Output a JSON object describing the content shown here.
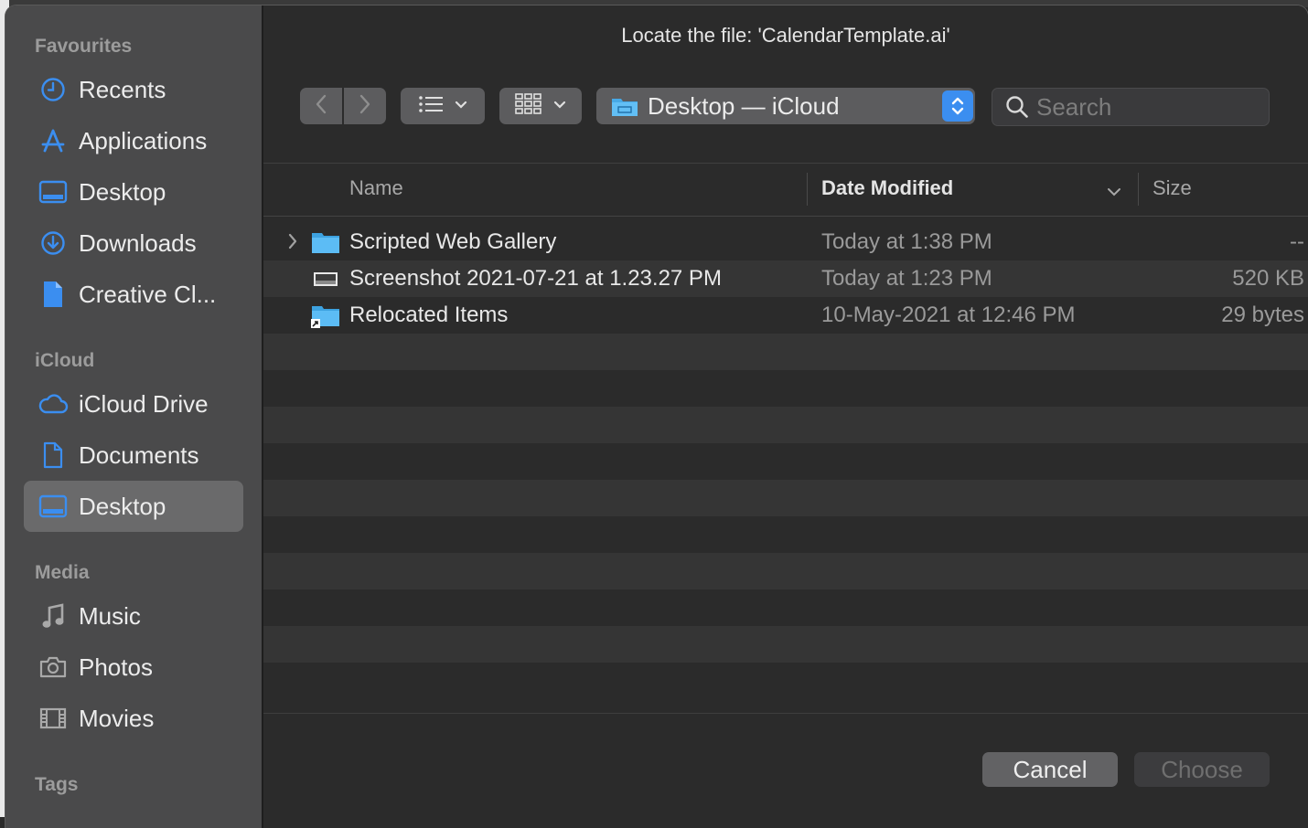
{
  "dialog": {
    "title": "Locate the file: 'CalendarTemplate.ai'"
  },
  "sidebar": {
    "sections": [
      {
        "label": "Favourites",
        "items": [
          {
            "label": "Recents",
            "icon": "clock-icon"
          },
          {
            "label": "Applications",
            "icon": "applications-icon"
          },
          {
            "label": "Desktop",
            "icon": "desktop-icon"
          },
          {
            "label": "Downloads",
            "icon": "downloads-icon"
          },
          {
            "label": "Creative Cl...",
            "icon": "document-icon"
          }
        ]
      },
      {
        "label": "iCloud",
        "items": [
          {
            "label": "iCloud Drive",
            "icon": "cloud-icon"
          },
          {
            "label": "Documents",
            "icon": "document-icon"
          },
          {
            "label": "Desktop",
            "icon": "desktop-icon",
            "selected": true
          }
        ]
      },
      {
        "label": "Media",
        "items": [
          {
            "label": "Music",
            "icon": "music-note-icon"
          },
          {
            "label": "Photos",
            "icon": "camera-icon"
          },
          {
            "label": "Movies",
            "icon": "film-icon"
          }
        ]
      },
      {
        "label": "Tags",
        "items": []
      }
    ]
  },
  "toolbar": {
    "location": "Desktop — iCloud",
    "search_placeholder": "Search"
  },
  "columns": {
    "name": "Name",
    "date": "Date Modified",
    "size": "Size"
  },
  "files": [
    {
      "name": "Scripted Web Gallery",
      "date": "Today at 1:38 PM",
      "size": "--",
      "kind": "folder",
      "expandable": true
    },
    {
      "name": "Screenshot 2021-07-21 at 1.23.27 PM",
      "date": "Today at 1:23 PM",
      "size": "520 KB",
      "kind": "image"
    },
    {
      "name": "Relocated Items",
      "date": "10-May-2021 at 12:46 PM",
      "size": "29 bytes",
      "kind": "alias-folder"
    }
  ],
  "buttons": {
    "cancel": "Cancel",
    "choose": "Choose"
  },
  "colors": {
    "accent": "#3b8ef0",
    "sidebar_bg": "#4a4a4b",
    "main_bg": "#2b2b2b"
  }
}
